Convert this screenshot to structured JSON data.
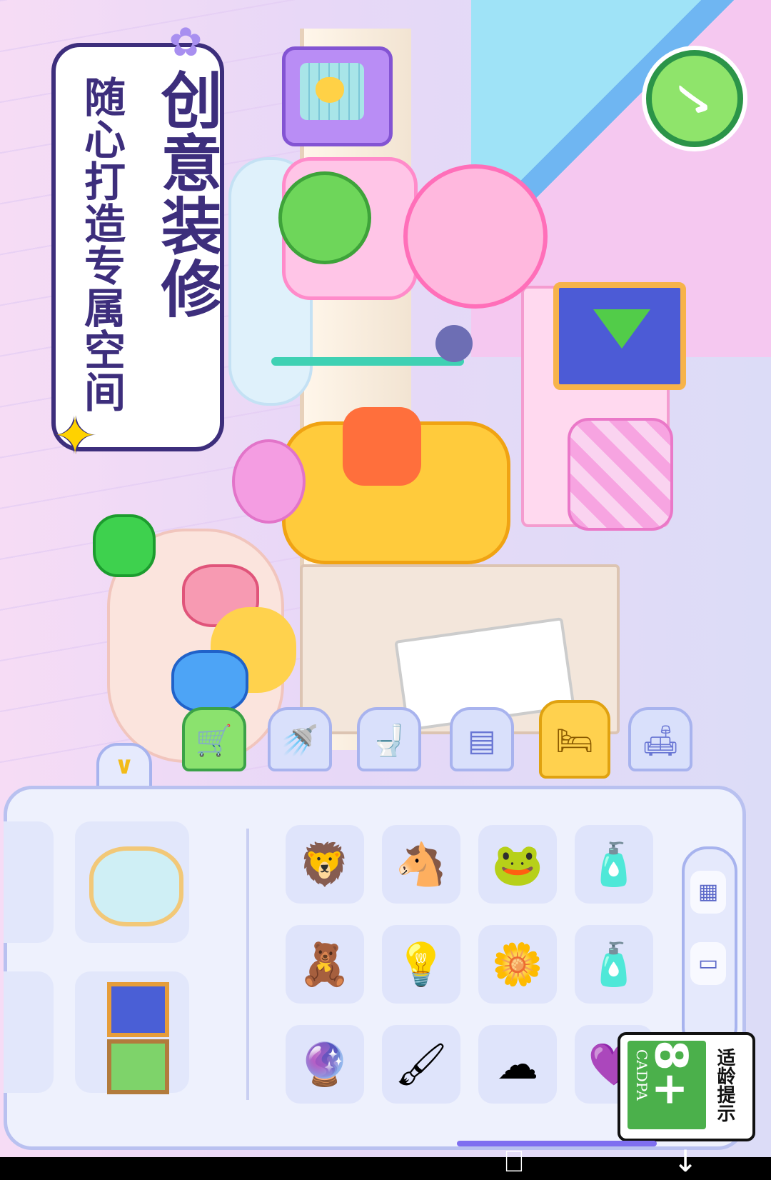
{
  "promo": {
    "title": "创意装修",
    "subtitle": "随心打造专属空间"
  },
  "icons": {
    "back": "back-check-icon",
    "collapse": "chevron-down-icon",
    "sparkle": "star-sparkle-icon",
    "flower": "flower-decoration-icon"
  },
  "category_tabs": [
    {
      "name": "shop-cart",
      "glyph": "🛒",
      "state": "green"
    },
    {
      "name": "bathroom-faucet",
      "glyph": "🚿",
      "state": "normal"
    },
    {
      "name": "toilet",
      "glyph": "🚽",
      "state": "normal"
    },
    {
      "name": "kitchen-microwave",
      "glyph": "▤",
      "state": "normal"
    },
    {
      "name": "bedroom-bed",
      "glyph": "🛏",
      "state": "active"
    },
    {
      "name": "living-sofa",
      "glyph": "🛋",
      "state": "normal"
    }
  ],
  "inventory": {
    "large_items": [
      "mirror",
      "picture-frames"
    ],
    "grid": [
      [
        "lion-plush",
        "pink-pony-plush",
        "green-frog-pillow",
        "pink-bottle"
      ],
      [
        "teddy-desk-lamp",
        "ring-lamp",
        "flower-pillow",
        "pink-lotion"
      ],
      [
        "snow-globe",
        "makeup-brush",
        "cloud-pillow",
        "purple-lamp"
      ]
    ],
    "grid_glyphs": [
      [
        "🦁",
        "🐴",
        "🐸",
        "🧴"
      ],
      [
        "🧸",
        "💡",
        "🌼",
        "🧴"
      ],
      [
        "🔮",
        "🖌",
        "☁",
        "💜"
      ]
    ],
    "side_tabs": [
      {
        "name": "cabinet",
        "glyph": "▦"
      },
      {
        "name": "tv",
        "glyph": "▭"
      }
    ]
  },
  "age_rating": {
    "value": "8+",
    "org": "CADPA",
    "label": "适龄提示"
  },
  "system_bar": {
    "rotate_glyph": "⎕",
    "download_glyph": "↓"
  },
  "colors": {
    "brand_dark": "#3d2e7c",
    "accent_yellow": "#ffd14e",
    "accent_green": "#8be26e"
  }
}
